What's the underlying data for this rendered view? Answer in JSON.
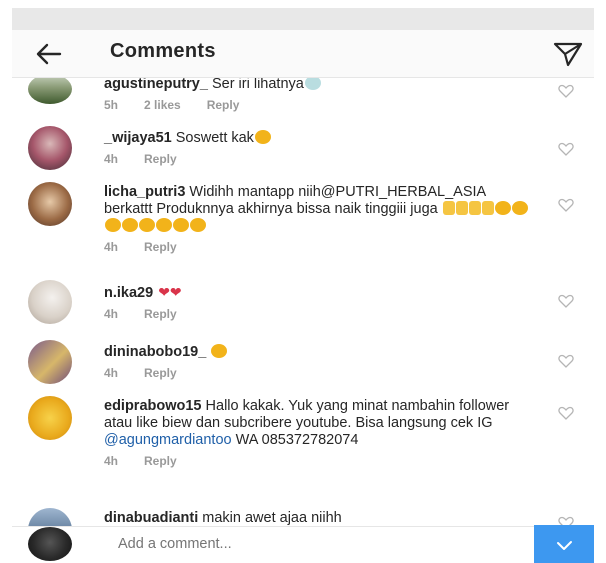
{
  "header": {
    "title": "Comments"
  },
  "comments": [
    {
      "username": "agustineputry_",
      "text": " Ser iri lihatnya",
      "time": "5h",
      "likes": "2 likes",
      "reply": "Reply"
    },
    {
      "username": "_wijaya51",
      "text": " Soswett kak",
      "time": "4h",
      "reply": "Reply"
    },
    {
      "username": "licha_putri3",
      "text": " Widihh mantapp niih@PUTRI_HERBAL_ASIA berkattt Produknnya akhirnya bissa naik tinggiii juga",
      "time": "4h",
      "reply": "Reply"
    },
    {
      "username": "n.ika29",
      "text": " ",
      "time": "4h",
      "reply": "Reply"
    },
    {
      "username": "dininabobo19_",
      "text": " ",
      "time": "4h",
      "reply": "Reply"
    },
    {
      "username": "ediprabowo15",
      "text": " Hallo kakak. Yuk yang minat nambahin follower atau like biew dan subcribere youtube. Bisa langsung cek IG ",
      "mention": "@agungmardiantoo",
      "text_after": " WA 085372782074",
      "time": "4h",
      "reply": "Reply"
    },
    {
      "username": "dinabuadianti",
      "text": " makin awet ajaa niihh"
    }
  ],
  "composer": {
    "placeholder": "Add a comment..."
  }
}
